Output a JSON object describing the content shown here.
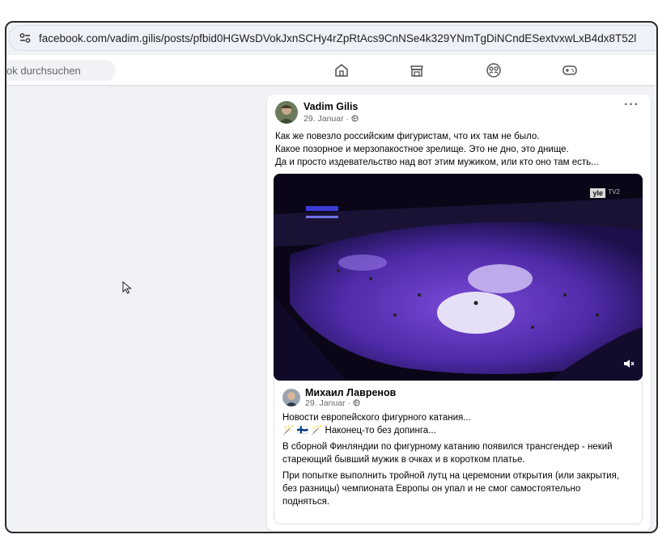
{
  "browser": {
    "url": "facebook.com/vadim.gilis/posts/pfbid0HGWsDVokJxnSCHy4rZpRtAcs9CnNSe4k329YNmTgDiNCndESextvxwLxB4dx8T52l"
  },
  "fb_header": {
    "search_text": "ok durchsuchen",
    "nav_icons": [
      "home-icon",
      "marketplace-icon",
      "groups-icon",
      "gaming-icon"
    ]
  },
  "post": {
    "author": "Vadim Gilis",
    "date": "29. Januar · ",
    "more_label": "···",
    "lines": [
      "Как же повезло российским фигуристам, что их там  не было.",
      "Какое позорное и мерзопакостное зрелище. Это не дно, это днище.",
      "Да и просто издевательство над вот этим мужиком, или кто оно там есть..."
    ],
    "video": {
      "logo_yle": "yle",
      "logo_tv2": "TV2"
    },
    "shared": {
      "author": "Михаил Лавренов",
      "date": "29. Januar · ",
      "line1": "Новости европейского фигурного катания...",
      "line2": "🪄 🇫🇮 🪄 Наконец-то без допинга...",
      "para1_lines": [
        "В сборной Финляндии по фигурному катанию появился трансгендер - некий",
        "стареющий бывший мужик в очках и в коротком платье."
      ],
      "para2_lines": [
        "При попытке выполнить тройной лутц на церемонии открытия (или закрытия,",
        "без разницы) чемпионата Европы он упал и не смог самостоятельно",
        "подняться."
      ]
    }
  }
}
